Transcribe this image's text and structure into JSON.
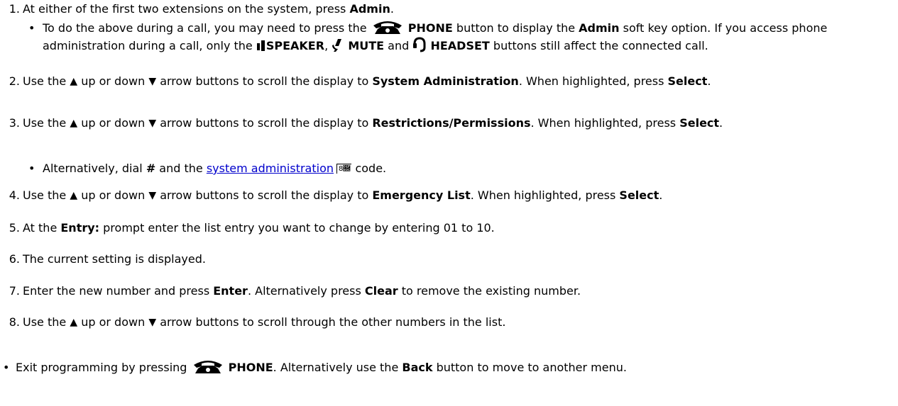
{
  "steps": [
    {
      "num": "1.",
      "parts": [
        "At either of the first two extensions on the system, press ",
        "Admin",
        "."
      ],
      "subs": [
        {
          "parts": [
            "To do the above during a call, you may need to press the ",
            "PHONE",
            " button to display the ",
            "Admin",
            " soft key option. If you access phone administration during a call, only the ",
            "SPEAKER",
            ", ",
            "MUTE",
            " and ",
            "HEADSET",
            " buttons still affect the connected call."
          ]
        }
      ]
    },
    {
      "num": "2.",
      "parts": [
        "Use the ",
        "up or down",
        "arrow buttons to scroll the display to ",
        "System Administration",
        ". When highlighted, press ",
        "Select",
        "."
      ]
    },
    {
      "num": "3.",
      "parts": [
        "Use the ",
        "up or down",
        "arrow buttons to scroll the display to ",
        "Restrictions/Permissions",
        ". When highlighted, press ",
        "Select",
        "."
      ],
      "subs": [
        {
          "parts": [
            "Alternatively, dial ",
            "#",
            " and the ",
            "system administration",
            "8",
            " code."
          ]
        }
      ]
    },
    {
      "num": "4.",
      "parts": [
        "Use the ",
        "up or down",
        "arrow buttons to scroll the display to ",
        "Emergency List",
        ". When highlighted, press ",
        "Select",
        "."
      ]
    },
    {
      "num": "5.",
      "parts": [
        "At the ",
        "Entry:",
        " prompt enter the list entry you want to change by entering 01 to 10."
      ]
    },
    {
      "num": "6.",
      "parts": [
        "The current setting is displayed."
      ]
    },
    {
      "num": "7.",
      "parts": [
        "Enter the new number and press ",
        "Enter",
        ". Alternatively press ",
        "Clear",
        " to remove the existing number."
      ]
    },
    {
      "num": "8.",
      "parts": [
        "Use the ",
        "up or down",
        "arrow buttons to scroll through the other numbers in the list."
      ]
    }
  ],
  "final_bullet": {
    "parts": [
      "Exit programming by pressing ",
      "PHONE",
      ". Alternatively use the ",
      "Back",
      " button to move to another menu."
    ]
  },
  "glyphs": {
    "up_arrow": "▲",
    "down_arrow": "▼",
    "bullet": "•"
  },
  "icons": [
    "phone-icon",
    "speaker-icon",
    "mute-icon",
    "headset-icon"
  ],
  "colors": {
    "link": "#0000cc",
    "text": "#000000"
  }
}
